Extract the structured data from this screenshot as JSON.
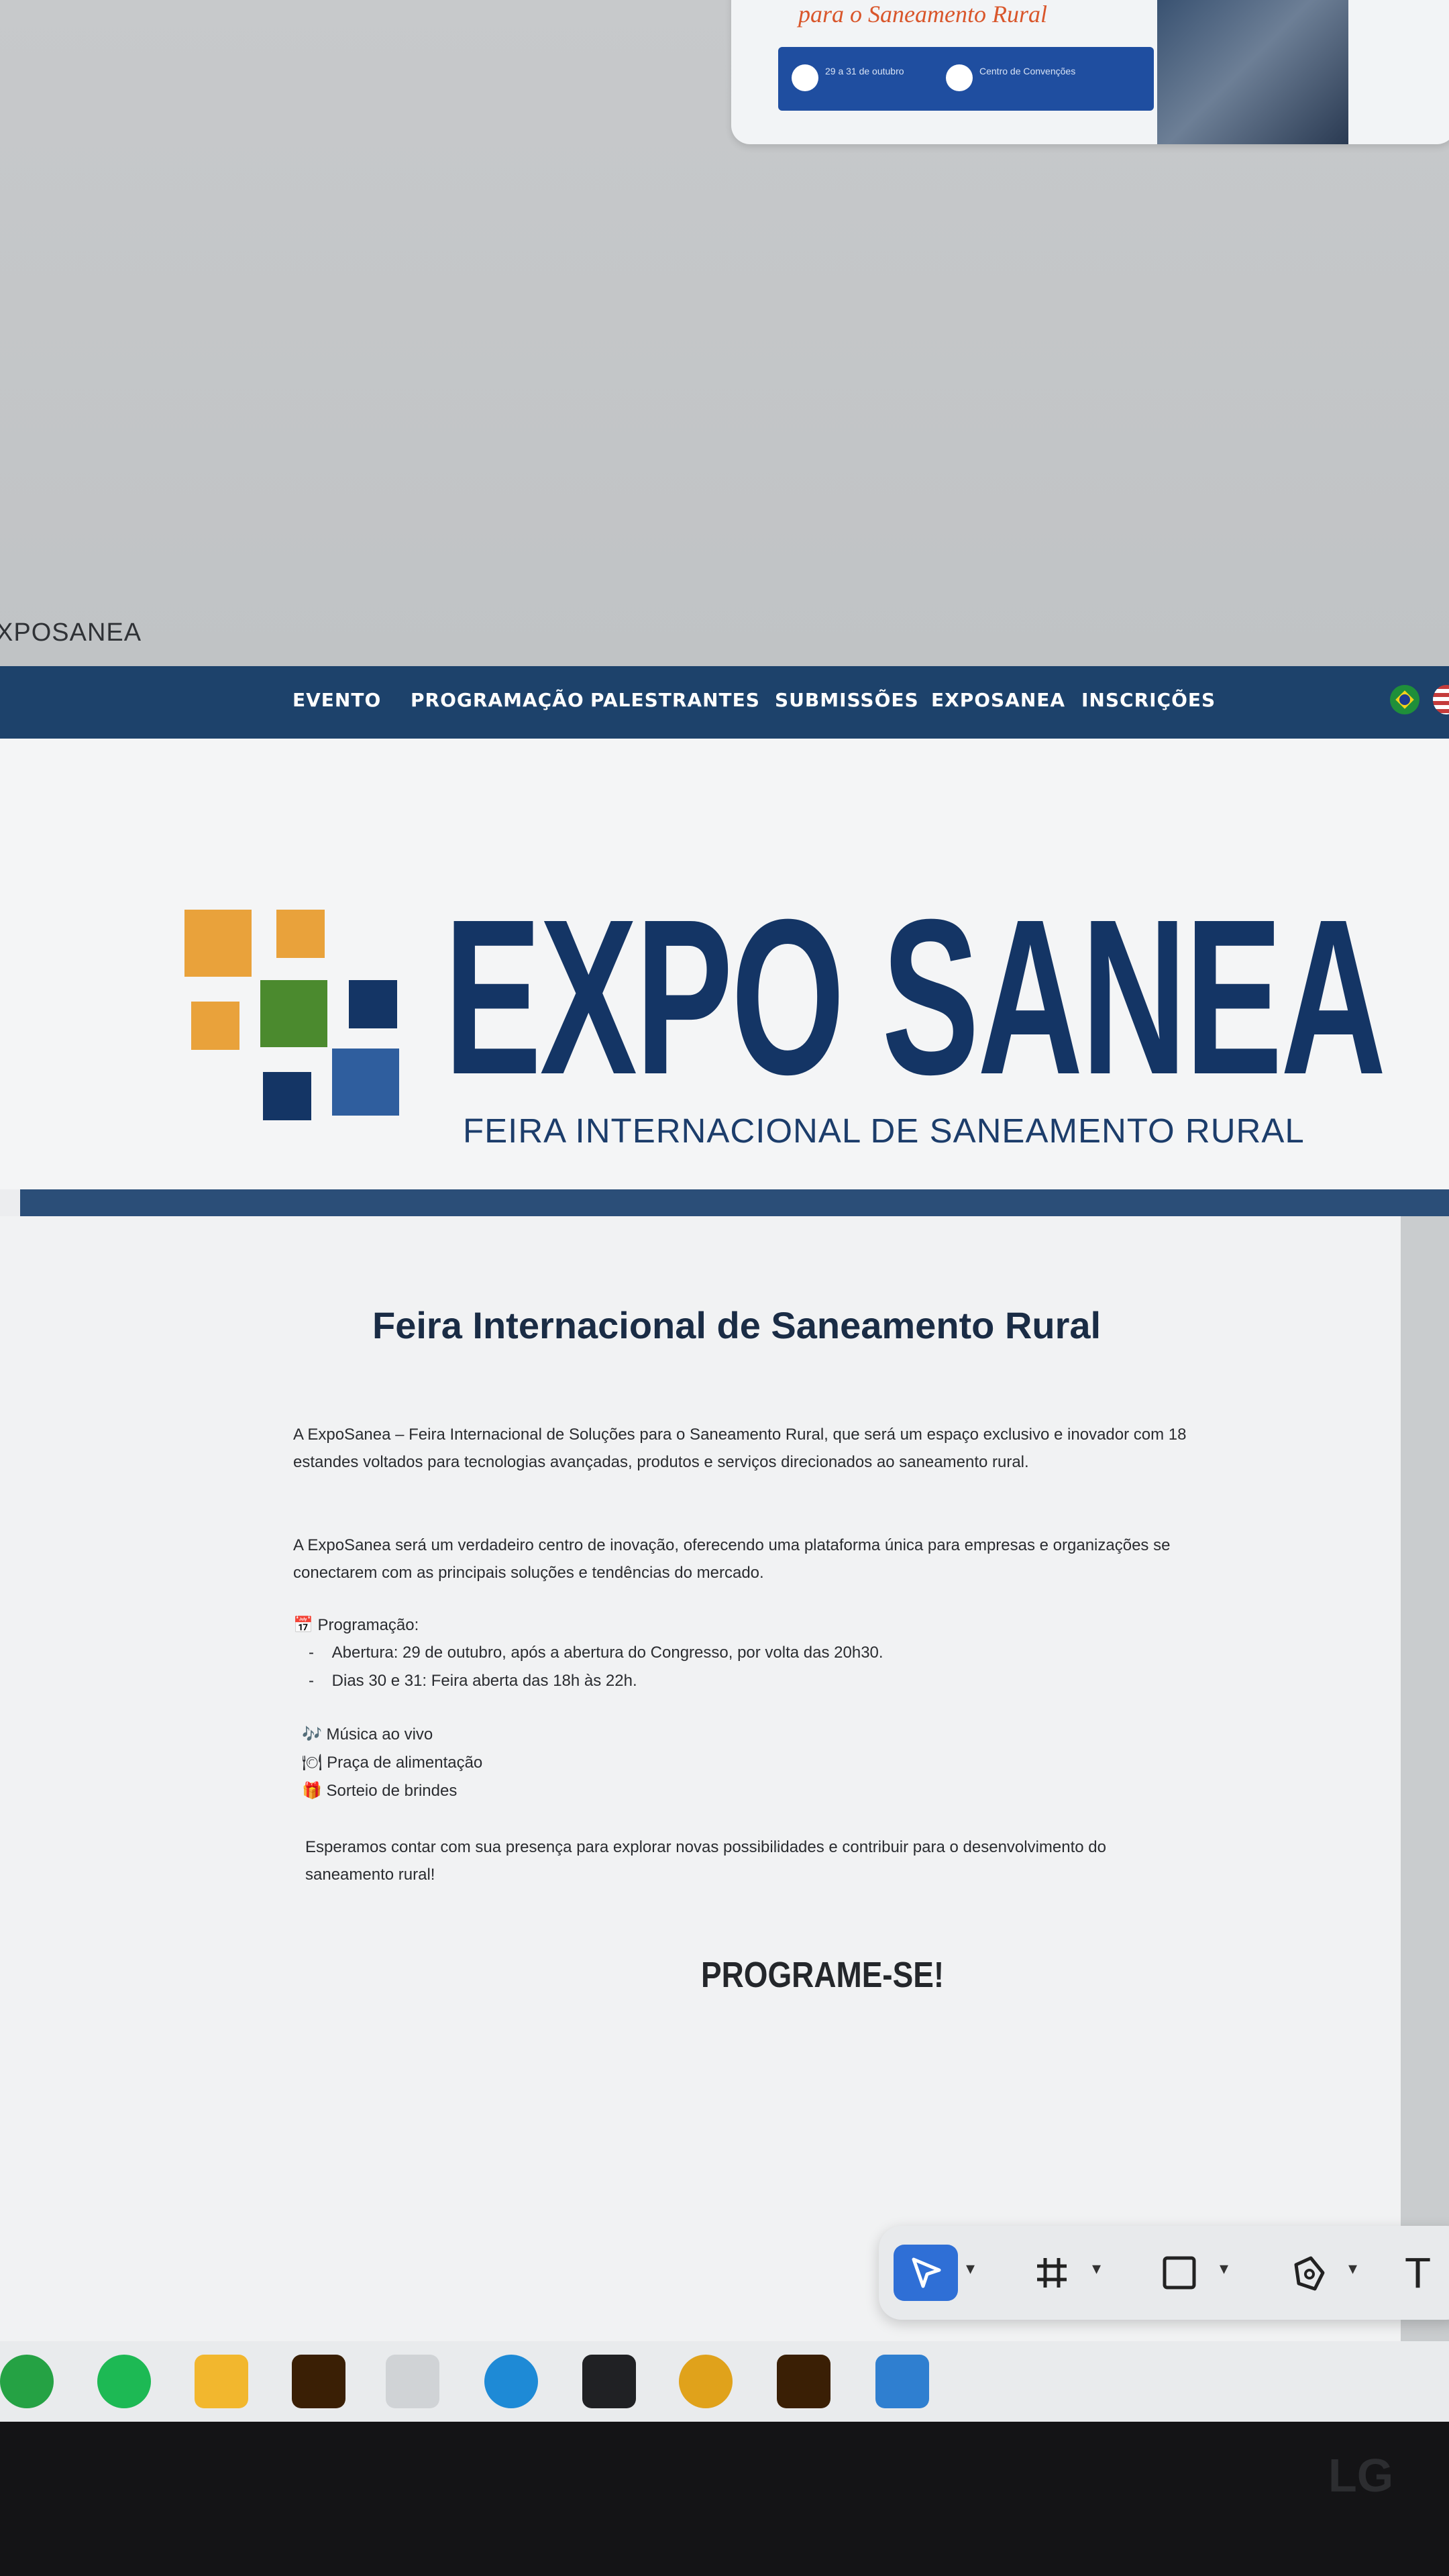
{
  "top_card": {
    "tagline": "para o Saneamento Rural",
    "info_date": "29 a 31 de outubro",
    "info_place": "Centro de Convenções"
  },
  "page_label": "XPOSANEA",
  "nav": {
    "items": [
      "EVENTO",
      "PROGRAMAÇÃO",
      "PALESTRANTES",
      "SUBMISSÕES",
      "EXPOSANEA",
      "INSCRIÇÕES"
    ]
  },
  "logo": {
    "title": "EXPO SANEA",
    "subtitle": "FEIRA INTERNACIONAL DE SANEAMENTO RURAL",
    "colors": {
      "orange": "#e9a23b",
      "green": "#4b8a2e",
      "navy": "#143565",
      "blue": "#2f5e9e"
    }
  },
  "content": {
    "heading": "Feira Internacional de Saneamento Rural",
    "paragraph1": "A ExpoSanea – Feira Internacional de Soluções para o Saneamento Rural, que será um espaço exclusivo e inovador com 18 estandes voltados para tecnologias avançadas, produtos e serviços direcionados ao saneamento rural.",
    "paragraph2": "A ExpoSanea será um verdadeiro centro de inovação, oferecendo uma plataforma única para empresas e organizações se conectarem com as principais soluções e tendências do mercado.",
    "programacao_title": "📅 Programação:",
    "programacao_items": [
      "Abertura: 29 de outubro, após a abertura do Congresso, por volta das 20h30.",
      "Dias 30 e 31: Feira aberta das 18h às 22h."
    ],
    "extras": [
      "🎶 Música ao vivo",
      "🍽 Praça de alimentação",
      "🎁 Sorteio de brindes"
    ],
    "closing": "Esperamos contar com sua presença para explorar novas possibilidades e contribuir para o desenvolvimento do saneamento rural!",
    "cta": "PROGRAME-SE!"
  },
  "toolbar": {
    "tools": [
      "select-tool",
      "frame-tool",
      "shape-tool",
      "pen-tool",
      "text-tool"
    ],
    "text_tool_glyph": "T"
  },
  "taskbar": {
    "apps": [
      "whatsapp",
      "spotify",
      "file-explorer",
      "illustrator",
      "cloud",
      "edge",
      "figma",
      "chrome",
      "illustrator",
      "photos"
    ]
  },
  "monitor_brand": "LG"
}
